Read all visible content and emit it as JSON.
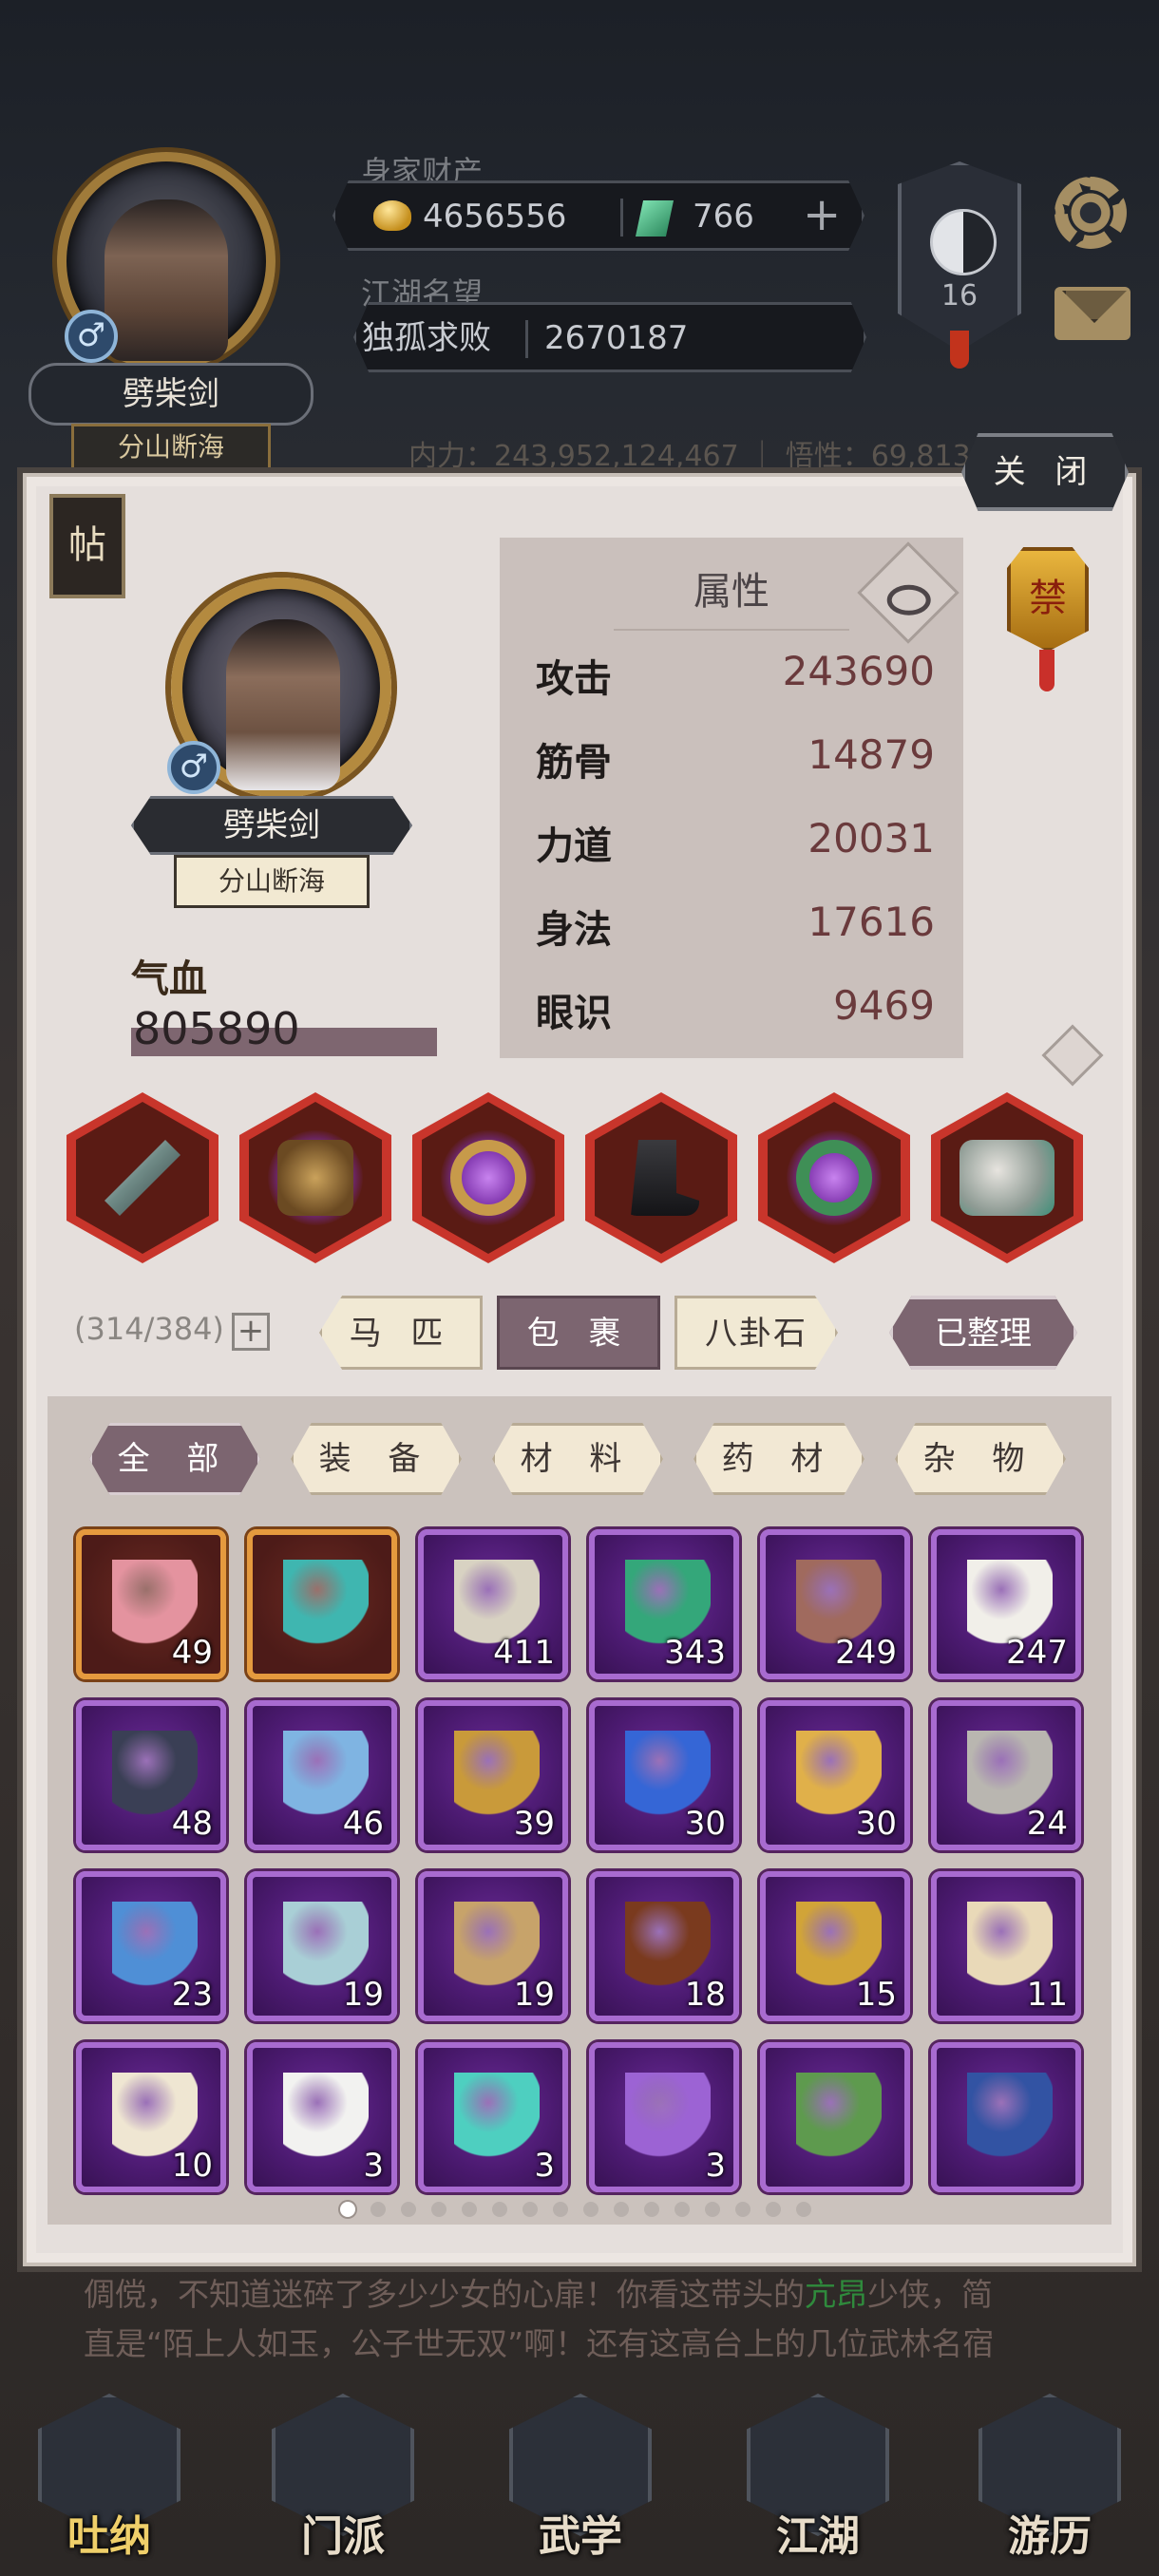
{
  "hud": {
    "name": "劈柴剑",
    "title": "分山断海",
    "wealth_label": "身家财产",
    "gold": "4656556",
    "jade": "766",
    "plus": "+",
    "fame_label": "江湖名望",
    "fame_rank": "独孤求败",
    "fame_value": "2670187",
    "taiji_level": "16",
    "stat_strip": "内力：243,952,124,467 ｜ 悟性：69,813",
    "gender": "♂"
  },
  "panel": {
    "close_label": "关 闭",
    "tie_label": "帖",
    "name": "劈柴剑",
    "title": "分山断海",
    "hp_label": "气血",
    "hp_value": "805890",
    "seal_char": "禁",
    "attributes": {
      "title": "属性",
      "rows": [
        {
          "key": "攻击",
          "value": "243690"
        },
        {
          "key": "筋骨",
          "value": "14879"
        },
        {
          "key": "力道",
          "value": "20031"
        },
        {
          "key": "身法",
          "value": "17616"
        },
        {
          "key": "眼识",
          "value": "9469"
        }
      ]
    },
    "equipment_icons": [
      "dagger-icon",
      "armor-icon",
      "ring-icon",
      "boots-icon",
      "jade-pendant-icon",
      "mount-elephant-icon"
    ],
    "bag_count": "(314/384)",
    "bag_plus": "+",
    "tabs": [
      "马 匹",
      "包 裹",
      "八卦石"
    ],
    "active_tab": 1,
    "sorted_label": "已整理",
    "filters": [
      "全 部",
      "装 备",
      "材 料",
      "药 材",
      "杂 物"
    ],
    "active_filter": 0,
    "items": [
      {
        "icon": "pink-pills-icon",
        "qty": "49",
        "rarity": "orange",
        "color": "#e4939f"
      },
      {
        "icon": "turquoise-egg-icon",
        "qty": "",
        "rarity": "orange",
        "color": "#3fb6b0"
      },
      {
        "icon": "scroll-fragment-icon",
        "qty": "411",
        "rarity": "purple",
        "color": "#d8d2c2"
      },
      {
        "icon": "green-crystal-icon",
        "qty": "343",
        "rarity": "purple",
        "color": "#34a77a"
      },
      {
        "icon": "meat-ore-icon",
        "qty": "249",
        "rarity": "purple",
        "color": "#a06a5e"
      },
      {
        "icon": "cotton-icon",
        "qty": "247",
        "rarity": "purple",
        "color": "#f1efe9"
      },
      {
        "icon": "dark-crystal-icon",
        "qty": "48",
        "rarity": "purple",
        "color": "#3a3f55"
      },
      {
        "icon": "ice-crystal-icon",
        "qty": "46",
        "rarity": "purple",
        "color": "#7fb4e2"
      },
      {
        "icon": "golden-puppet-icon",
        "qty": "39",
        "rarity": "purple",
        "color": "#c99a3a"
      },
      {
        "icon": "blue-orb-icon",
        "qty": "30",
        "rarity": "purple",
        "color": "#3566d6"
      },
      {
        "icon": "gold-shard-icon",
        "qty": "30",
        "rarity": "purple",
        "color": "#e0b04a"
      },
      {
        "icon": "stone-tablet-icon",
        "qty": "24",
        "rarity": "purple",
        "color": "#b9b6b0"
      },
      {
        "icon": "blue-powder-icon",
        "qty": "23",
        "rarity": "purple",
        "color": "#4f8fd6"
      },
      {
        "icon": "jade-slip-icon",
        "qty": "19",
        "rarity": "purple",
        "color": "#a9cfd6"
      },
      {
        "icon": "bronze-token-icon",
        "qty": "19",
        "rarity": "purple",
        "color": "#c7a36a"
      },
      {
        "icon": "wine-jar-icon",
        "qty": "18",
        "rarity": "purple",
        "color": "#7a3a1e"
      },
      {
        "icon": "gold-badge-icon",
        "qty": "15",
        "rarity": "purple",
        "color": "#d1a438"
      },
      {
        "icon": "red-book-icon",
        "qty": "11",
        "rarity": "purple",
        "color": "#e9d9b8"
      },
      {
        "icon": "letter-icon",
        "qty": "10",
        "rarity": "purple",
        "color": "#efe6d2"
      },
      {
        "icon": "pearl-icon",
        "qty": "3",
        "rarity": "purple",
        "color": "#f2f2f0"
      },
      {
        "icon": "teal-bead-icon",
        "qty": "3",
        "rarity": "purple",
        "color": "#4ecfc0"
      },
      {
        "icon": "purple-incense-icon",
        "qty": "3",
        "rarity": "purple",
        "color": "#9c63d4"
      },
      {
        "icon": "green-jade-icon",
        "qty": "",
        "rarity": "purple",
        "color": "#5e9a4e"
      },
      {
        "icon": "blue-manual-icon",
        "qty": "",
        "rarity": "purple",
        "color": "#3253a3"
      }
    ],
    "page_count": 16,
    "active_page": 0
  },
  "story": {
    "line1_a": "倜傥，不知道迷碎了多少少女的心扉！你看这带头的",
    "line1_hl": "亢昂",
    "line1_b": "少侠，简",
    "line2": "直是“陌上人如玉，公子世无双”啊！还有这高台上的几位武林名宿"
  },
  "nav": [
    {
      "label": "吐纳",
      "icon": "meditation-icon"
    },
    {
      "label": "门派",
      "icon": "sect-banner-icon"
    },
    {
      "label": "武学",
      "icon": "martial-book-icon"
    },
    {
      "label": "江湖",
      "icon": "straw-hat-icon"
    },
    {
      "label": "游历",
      "icon": "horse-icon"
    }
  ]
}
